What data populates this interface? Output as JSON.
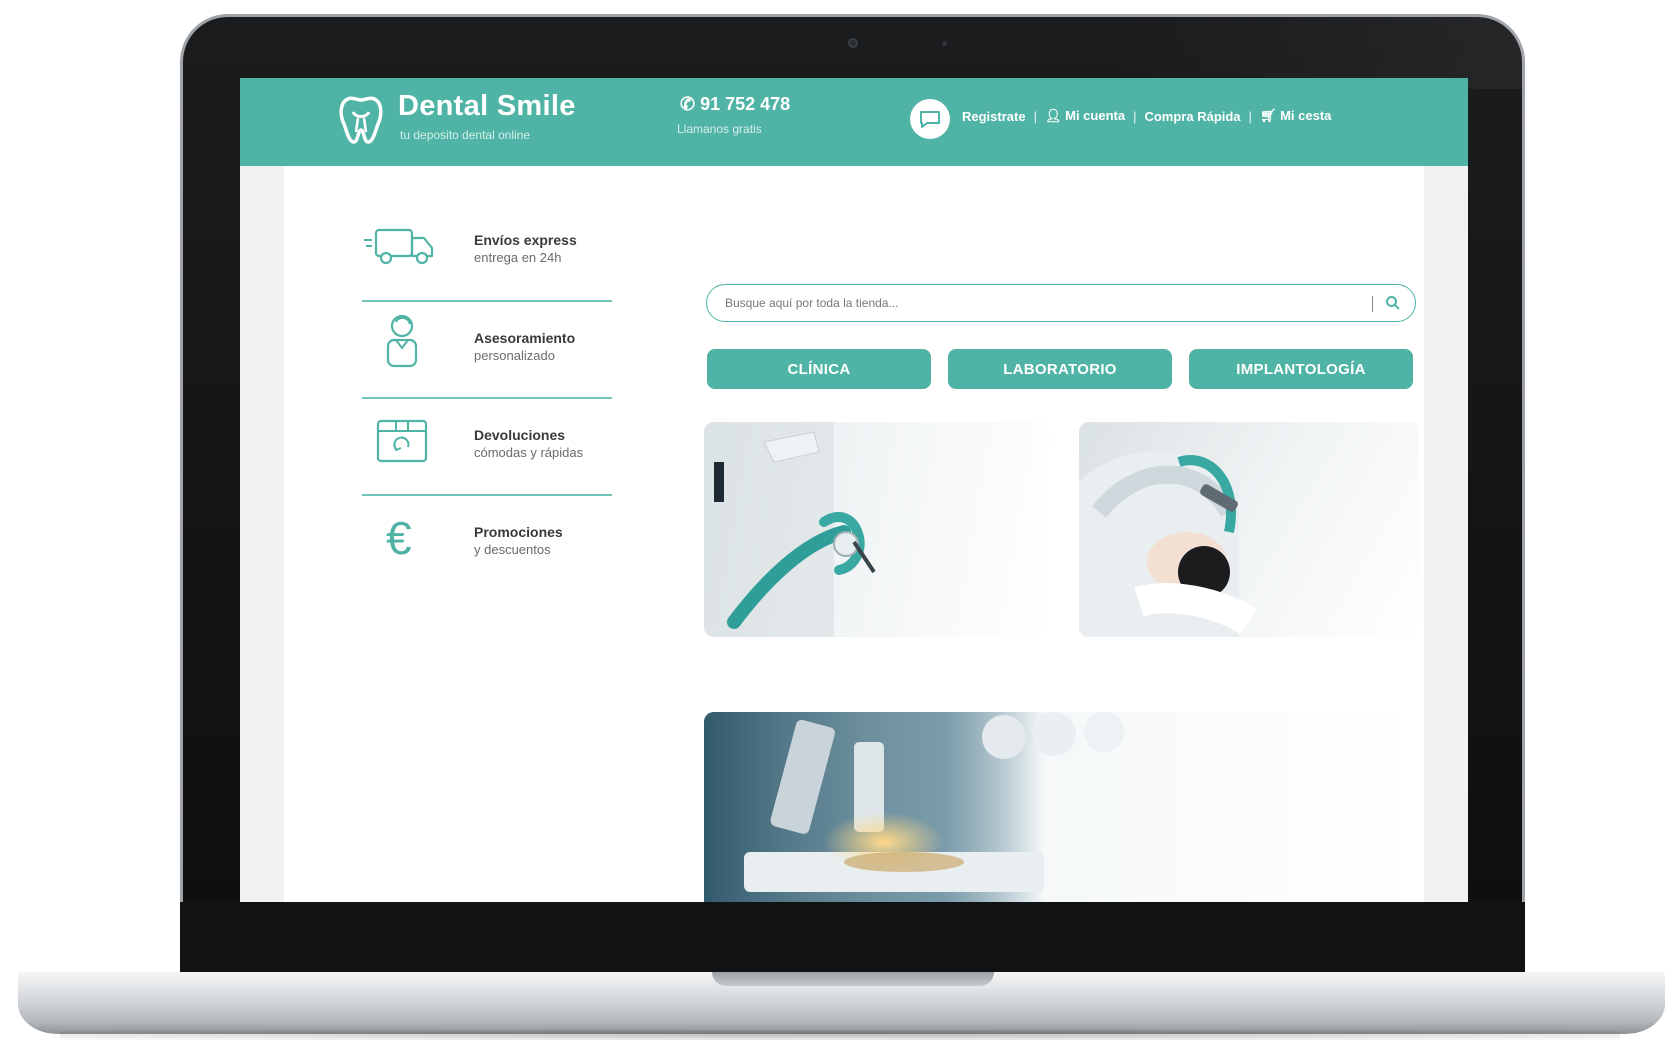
{
  "header": {
    "brand": "Dental Smile",
    "tagline": "tu deposito dental online",
    "phone": "91 752 478",
    "phone_note": "Llamanos gratis",
    "links": {
      "register": "Registrate",
      "account": "Mi cuenta",
      "quick_buy": "Compra Rápida",
      "cart": "Mi cesta"
    }
  },
  "benefits": [
    {
      "icon": "truck-icon",
      "title": "Envíos express",
      "subtitle": "entrega en 24h"
    },
    {
      "icon": "advisor-icon",
      "title": "Asesoramiento",
      "subtitle": "personalizado"
    },
    {
      "icon": "box-return-icon",
      "title": "Devoluciones",
      "subtitle": "cómodas y rápidas"
    },
    {
      "icon": "euro-icon",
      "title": "Promociones",
      "subtitle": "y descuentos"
    }
  ],
  "search": {
    "placeholder": "Busque aquí por toda la tienda..."
  },
  "categories": [
    "CLÍNICA",
    "LABORATORIO",
    "IMPLANTOLOGÍA"
  ],
  "colors": {
    "accent": "#4fb3a5",
    "text_dark": "#3a3a3a",
    "text_muted": "#6b6b6b"
  }
}
